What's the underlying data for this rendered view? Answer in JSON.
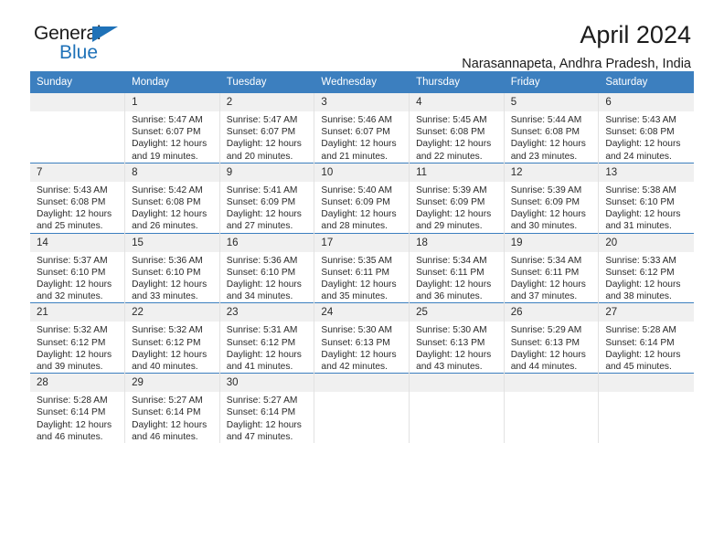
{
  "brand": {
    "name_top": "General",
    "name_bottom": "Blue",
    "accent_color": "#1f72b8"
  },
  "header": {
    "title": "April 2024",
    "subtitle": "Narasannapeta, Andhra Pradesh, India"
  },
  "calendar": {
    "header_bg": "#3c7fbf",
    "daynum_bg": "#f0f0f0",
    "weekdays": [
      "Sunday",
      "Monday",
      "Tuesday",
      "Wednesday",
      "Thursday",
      "Friday",
      "Saturday"
    ],
    "weeks": [
      [
        {
          "day": "",
          "sunrise": "",
          "sunset": "",
          "daylight": ""
        },
        {
          "day": "1",
          "sunrise": "Sunrise: 5:47 AM",
          "sunset": "Sunset: 6:07 PM",
          "daylight": "Daylight: 12 hours and 19 minutes."
        },
        {
          "day": "2",
          "sunrise": "Sunrise: 5:47 AM",
          "sunset": "Sunset: 6:07 PM",
          "daylight": "Daylight: 12 hours and 20 minutes."
        },
        {
          "day": "3",
          "sunrise": "Sunrise: 5:46 AM",
          "sunset": "Sunset: 6:07 PM",
          "daylight": "Daylight: 12 hours and 21 minutes."
        },
        {
          "day": "4",
          "sunrise": "Sunrise: 5:45 AM",
          "sunset": "Sunset: 6:08 PM",
          "daylight": "Daylight: 12 hours and 22 minutes."
        },
        {
          "day": "5",
          "sunrise": "Sunrise: 5:44 AM",
          "sunset": "Sunset: 6:08 PM",
          "daylight": "Daylight: 12 hours and 23 minutes."
        },
        {
          "day": "6",
          "sunrise": "Sunrise: 5:43 AM",
          "sunset": "Sunset: 6:08 PM",
          "daylight": "Daylight: 12 hours and 24 minutes."
        }
      ],
      [
        {
          "day": "7",
          "sunrise": "Sunrise: 5:43 AM",
          "sunset": "Sunset: 6:08 PM",
          "daylight": "Daylight: 12 hours and 25 minutes."
        },
        {
          "day": "8",
          "sunrise": "Sunrise: 5:42 AM",
          "sunset": "Sunset: 6:08 PM",
          "daylight": "Daylight: 12 hours and 26 minutes."
        },
        {
          "day": "9",
          "sunrise": "Sunrise: 5:41 AM",
          "sunset": "Sunset: 6:09 PM",
          "daylight": "Daylight: 12 hours and 27 minutes."
        },
        {
          "day": "10",
          "sunrise": "Sunrise: 5:40 AM",
          "sunset": "Sunset: 6:09 PM",
          "daylight": "Daylight: 12 hours and 28 minutes."
        },
        {
          "day": "11",
          "sunrise": "Sunrise: 5:39 AM",
          "sunset": "Sunset: 6:09 PM",
          "daylight": "Daylight: 12 hours and 29 minutes."
        },
        {
          "day": "12",
          "sunrise": "Sunrise: 5:39 AM",
          "sunset": "Sunset: 6:09 PM",
          "daylight": "Daylight: 12 hours and 30 minutes."
        },
        {
          "day": "13",
          "sunrise": "Sunrise: 5:38 AM",
          "sunset": "Sunset: 6:10 PM",
          "daylight": "Daylight: 12 hours and 31 minutes."
        }
      ],
      [
        {
          "day": "14",
          "sunrise": "Sunrise: 5:37 AM",
          "sunset": "Sunset: 6:10 PM",
          "daylight": "Daylight: 12 hours and 32 minutes."
        },
        {
          "day": "15",
          "sunrise": "Sunrise: 5:36 AM",
          "sunset": "Sunset: 6:10 PM",
          "daylight": "Daylight: 12 hours and 33 minutes."
        },
        {
          "day": "16",
          "sunrise": "Sunrise: 5:36 AM",
          "sunset": "Sunset: 6:10 PM",
          "daylight": "Daylight: 12 hours and 34 minutes."
        },
        {
          "day": "17",
          "sunrise": "Sunrise: 5:35 AM",
          "sunset": "Sunset: 6:11 PM",
          "daylight": "Daylight: 12 hours and 35 minutes."
        },
        {
          "day": "18",
          "sunrise": "Sunrise: 5:34 AM",
          "sunset": "Sunset: 6:11 PM",
          "daylight": "Daylight: 12 hours and 36 minutes."
        },
        {
          "day": "19",
          "sunrise": "Sunrise: 5:34 AM",
          "sunset": "Sunset: 6:11 PM",
          "daylight": "Daylight: 12 hours and 37 minutes."
        },
        {
          "day": "20",
          "sunrise": "Sunrise: 5:33 AM",
          "sunset": "Sunset: 6:12 PM",
          "daylight": "Daylight: 12 hours and 38 minutes."
        }
      ],
      [
        {
          "day": "21",
          "sunrise": "Sunrise: 5:32 AM",
          "sunset": "Sunset: 6:12 PM",
          "daylight": "Daylight: 12 hours and 39 minutes."
        },
        {
          "day": "22",
          "sunrise": "Sunrise: 5:32 AM",
          "sunset": "Sunset: 6:12 PM",
          "daylight": "Daylight: 12 hours and 40 minutes."
        },
        {
          "day": "23",
          "sunrise": "Sunrise: 5:31 AM",
          "sunset": "Sunset: 6:12 PM",
          "daylight": "Daylight: 12 hours and 41 minutes."
        },
        {
          "day": "24",
          "sunrise": "Sunrise: 5:30 AM",
          "sunset": "Sunset: 6:13 PM",
          "daylight": "Daylight: 12 hours and 42 minutes."
        },
        {
          "day": "25",
          "sunrise": "Sunrise: 5:30 AM",
          "sunset": "Sunset: 6:13 PM",
          "daylight": "Daylight: 12 hours and 43 minutes."
        },
        {
          "day": "26",
          "sunrise": "Sunrise: 5:29 AM",
          "sunset": "Sunset: 6:13 PM",
          "daylight": "Daylight: 12 hours and 44 minutes."
        },
        {
          "day": "27",
          "sunrise": "Sunrise: 5:28 AM",
          "sunset": "Sunset: 6:14 PM",
          "daylight": "Daylight: 12 hours and 45 minutes."
        }
      ],
      [
        {
          "day": "28",
          "sunrise": "Sunrise: 5:28 AM",
          "sunset": "Sunset: 6:14 PM",
          "daylight": "Daylight: 12 hours and 46 minutes."
        },
        {
          "day": "29",
          "sunrise": "Sunrise: 5:27 AM",
          "sunset": "Sunset: 6:14 PM",
          "daylight": "Daylight: 12 hours and 46 minutes."
        },
        {
          "day": "30",
          "sunrise": "Sunrise: 5:27 AM",
          "sunset": "Sunset: 6:14 PM",
          "daylight": "Daylight: 12 hours and 47 minutes."
        },
        {
          "day": "",
          "sunrise": "",
          "sunset": "",
          "daylight": ""
        },
        {
          "day": "",
          "sunrise": "",
          "sunset": "",
          "daylight": ""
        },
        {
          "day": "",
          "sunrise": "",
          "sunset": "",
          "daylight": ""
        },
        {
          "day": "",
          "sunrise": "",
          "sunset": "",
          "daylight": ""
        }
      ]
    ]
  }
}
